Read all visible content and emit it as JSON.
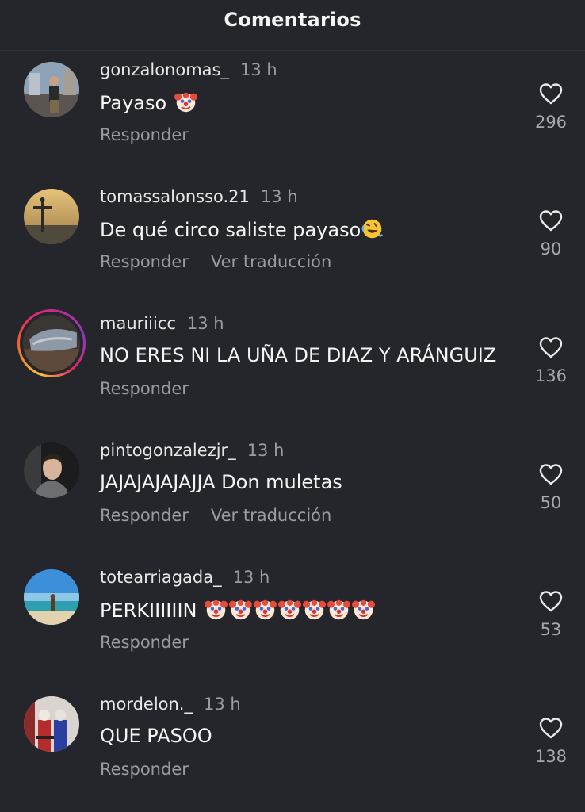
{
  "header": {
    "title": "Comentarios"
  },
  "comments": [
    {
      "username": "gonzalonomas_",
      "time": "13 h",
      "text": "Payaso",
      "emoji_count": 1,
      "reply_label": "Responder",
      "translate_label": "",
      "likes": "296",
      "avatar": "photo-man-street",
      "has_story": false
    },
    {
      "username": "tomassalonsso.21",
      "time": "13 h",
      "text": "De qué circo saliste payaso",
      "emoji_count": 1,
      "reply_label": "Responder",
      "translate_label": "Ver traducción",
      "likes": "90",
      "avatar": "photo-statue-sunset",
      "has_story": false
    },
    {
      "username": "mauriiicc",
      "time": "13 h",
      "text": "NO ERES NI LA UÑA DE DIAZ Y ARÁNGUIZ",
      "emoji_count": 0,
      "reply_label": "Responder",
      "translate_label": "",
      "likes": "136",
      "avatar": "photo-dark-object",
      "has_story": true
    },
    {
      "username": "pintogonzalezjr_",
      "time": "13 h",
      "text": "JAJAJAJAJAJJA Don muletas",
      "emoji_count": 0,
      "reply_label": "Responder",
      "translate_label": "Ver traducción",
      "likes": "50",
      "avatar": "photo-young-man",
      "has_story": false
    },
    {
      "username": "totearriagada_",
      "time": "13 h",
      "text": "PERKIIIIIIN",
      "emoji_count": 7,
      "reply_label": "Responder",
      "translate_label": "",
      "likes": "53",
      "avatar": "photo-beach",
      "has_story": false
    },
    {
      "username": "mordelon._",
      "time": "13 h",
      "text": "QUE PASOO",
      "emoji_count": 0,
      "reply_label": "Responder",
      "translate_label": "",
      "likes": "138",
      "avatar": "photo-two-people",
      "has_story": false
    }
  ],
  "icons": {
    "like": "heart-outline-icon",
    "clown": "clown-face-emoji",
    "laugh": "rolling-on-floor-laughing-emoji"
  },
  "colors": {
    "background": "#25262b",
    "secondary_text": "#9a9ba0",
    "story_ring": "#e6295f"
  }
}
